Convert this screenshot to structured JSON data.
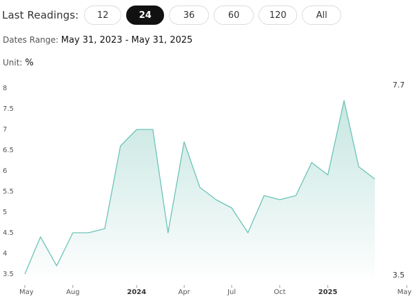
{
  "toolbar": {
    "label": "Last Readings:",
    "options": [
      {
        "label": "12",
        "active": false
      },
      {
        "label": "24",
        "active": true
      },
      {
        "label": "36",
        "active": false
      },
      {
        "label": "60",
        "active": false
      },
      {
        "label": "120",
        "active": false
      },
      {
        "label": "All",
        "active": false
      }
    ]
  },
  "range": {
    "label": "Dates Range:",
    "value": "May 31, 2023 - May 31, 2025"
  },
  "unit": {
    "label": "Unit:",
    "value": "%"
  },
  "colors": {
    "line": "#6cc3b8",
    "fill_top": "#bfe3dd",
    "fill_bottom": "#ffffff",
    "active_pill": "#111111"
  },
  "chart_data": {
    "type": "area",
    "ylim": [
      3.5,
      8
    ],
    "y_ticks": [
      "3.5",
      "4",
      "4.5",
      "5",
      "5.5",
      "6",
      "6.5",
      "7",
      "7.5",
      "8"
    ],
    "x_ticks": [
      {
        "label": "May",
        "date": "2023-05-31",
        "bold": false
      },
      {
        "label": "Aug",
        "date": "2023-08-31",
        "bold": false
      },
      {
        "label": "2024",
        "date": "2023-12-31",
        "bold": true
      },
      {
        "label": "Apr",
        "date": "2024-03-31",
        "bold": false
      },
      {
        "label": "Jul",
        "date": "2024-06-30",
        "bold": false
      },
      {
        "label": "Oct",
        "date": "2024-09-30",
        "bold": false
      },
      {
        "label": "2025",
        "date": "2024-12-31",
        "bold": true
      },
      {
        "label": "May",
        "date": "2025-05-31",
        "bold": false
      }
    ],
    "series": [
      {
        "points": [
          {
            "x": "2023-05-31",
            "y": 3.5
          },
          {
            "x": "2023-06-30",
            "y": 4.4
          },
          {
            "x": "2023-07-31",
            "y": 3.7
          },
          {
            "x": "2023-08-31",
            "y": 4.5
          },
          {
            "x": "2023-09-30",
            "y": 4.5
          },
          {
            "x": "2023-10-31",
            "y": 4.6
          },
          {
            "x": "2023-11-30",
            "y": 6.6
          },
          {
            "x": "2023-12-31",
            "y": 7.0
          },
          {
            "x": "2024-01-31",
            "y": 7.0
          },
          {
            "x": "2024-02-29",
            "y": 4.5
          },
          {
            "x": "2024-03-31",
            "y": 6.7
          },
          {
            "x": "2024-04-30",
            "y": 5.6
          },
          {
            "x": "2024-05-31",
            "y": 5.3
          },
          {
            "x": "2024-06-30",
            "y": 5.1
          },
          {
            "x": "2024-07-31",
            "y": 4.5
          },
          {
            "x": "2024-08-31",
            "y": 5.4
          },
          {
            "x": "2024-09-30",
            "y": 5.3
          },
          {
            "x": "2024-10-31",
            "y": 5.4
          },
          {
            "x": "2024-11-30",
            "y": 6.2
          },
          {
            "x": "2024-12-31",
            "y": 5.9
          },
          {
            "x": "2025-01-31",
            "y": 7.7
          },
          {
            "x": "2025-02-28",
            "y": 6.1
          },
          {
            "x": "2025-03-31",
            "y": 5.8
          }
        ]
      }
    ],
    "annotations": {
      "max_label": "7.7",
      "min_label": "3.5"
    }
  }
}
